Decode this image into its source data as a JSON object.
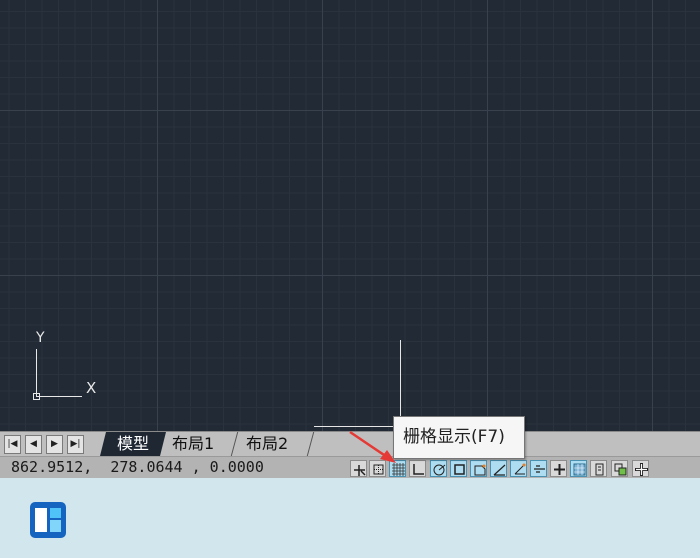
{
  "canvas": {
    "ucs_y_label": "Y",
    "ucs_x_label": "X",
    "background_color": "#222a35"
  },
  "tabs": {
    "nav": [
      "first-icon",
      "prev-icon",
      "next-icon",
      "last-icon"
    ],
    "items": [
      {
        "label": "模型",
        "active": true
      },
      {
        "label": "布局1",
        "active": false
      },
      {
        "label": "布局2",
        "active": false
      }
    ]
  },
  "statusbar": {
    "coordinates": "862.9512,  278.0644 , 0.0000",
    "buttons": [
      {
        "name": "infer-constraints-icon",
        "on": false
      },
      {
        "name": "snap-mode-icon",
        "on": false
      },
      {
        "name": "grid-display-icon",
        "on": true
      },
      {
        "name": "ortho-mode-icon",
        "on": false
      },
      {
        "name": "polar-tracking-icon",
        "on": true
      },
      {
        "name": "object-snap-icon",
        "on": true
      },
      {
        "name": "3d-object-snap-icon",
        "on": true
      },
      {
        "name": "object-snap-tracking-icon",
        "on": true
      },
      {
        "name": "dynamic-ucs-icon",
        "on": true
      },
      {
        "name": "dynamic-input-icon",
        "on": true
      },
      {
        "name": "lineweight-icon",
        "on": false
      },
      {
        "name": "transparency-icon",
        "on": true
      },
      {
        "name": "quick-properties-icon",
        "on": false
      },
      {
        "name": "selection-cycling-icon",
        "on": false
      },
      {
        "name": "annotation-monitor-icon",
        "on": false
      }
    ]
  },
  "tooltip": {
    "text": "栅格显示(F7)"
  },
  "annotation": {
    "arrow_color": "#e53935"
  }
}
